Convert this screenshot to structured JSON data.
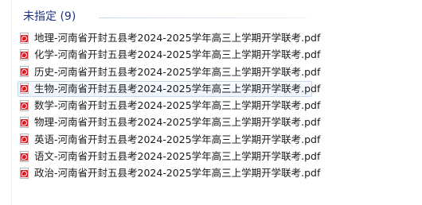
{
  "group": {
    "title": "未指定 (9)"
  },
  "files": [
    {
      "name": "地理-河南省开封五县考2024-2025学年高三上学期开学联考.pdf",
      "icon": "pdf-icon"
    },
    {
      "name": "化学-河南省开封五县考2024-2025学年高三上学期开学联考.pdf",
      "icon": "pdf-icon"
    },
    {
      "name": "历史-河南省开封五县考2024-2025学年高三上学期开学联考.pdf",
      "icon": "pdf-icon"
    },
    {
      "name": "生物-河南省开封五县考2024-2025学年高三上学期开学联考.pdf",
      "icon": "pdf-icon",
      "state": "hover"
    },
    {
      "name": "数学-河南省开封五县考2024-2025学年高三上学期开学联考.pdf",
      "icon": "pdf-icon"
    },
    {
      "name": "物理-河南省开封五县考2024-2025学年高三上学期开学联考.pdf",
      "icon": "pdf-icon"
    },
    {
      "name": "英语-河南省开封五县考2024-2025学年高三上学期开学联考.pdf",
      "icon": "pdf-icon"
    },
    {
      "name": "语文-河南省开封五县考2024-2025学年高三上学期开学联考.pdf",
      "icon": "pdf-icon"
    },
    {
      "name": "政治-河南省开封五县考2024-2025学年高三上学期开学联考.pdf",
      "icon": "pdf-icon"
    }
  ],
  "colors": {
    "group_title": "#1e3287",
    "pdf_red": "#d71e24",
    "hover_border": "#c5d7ee"
  }
}
